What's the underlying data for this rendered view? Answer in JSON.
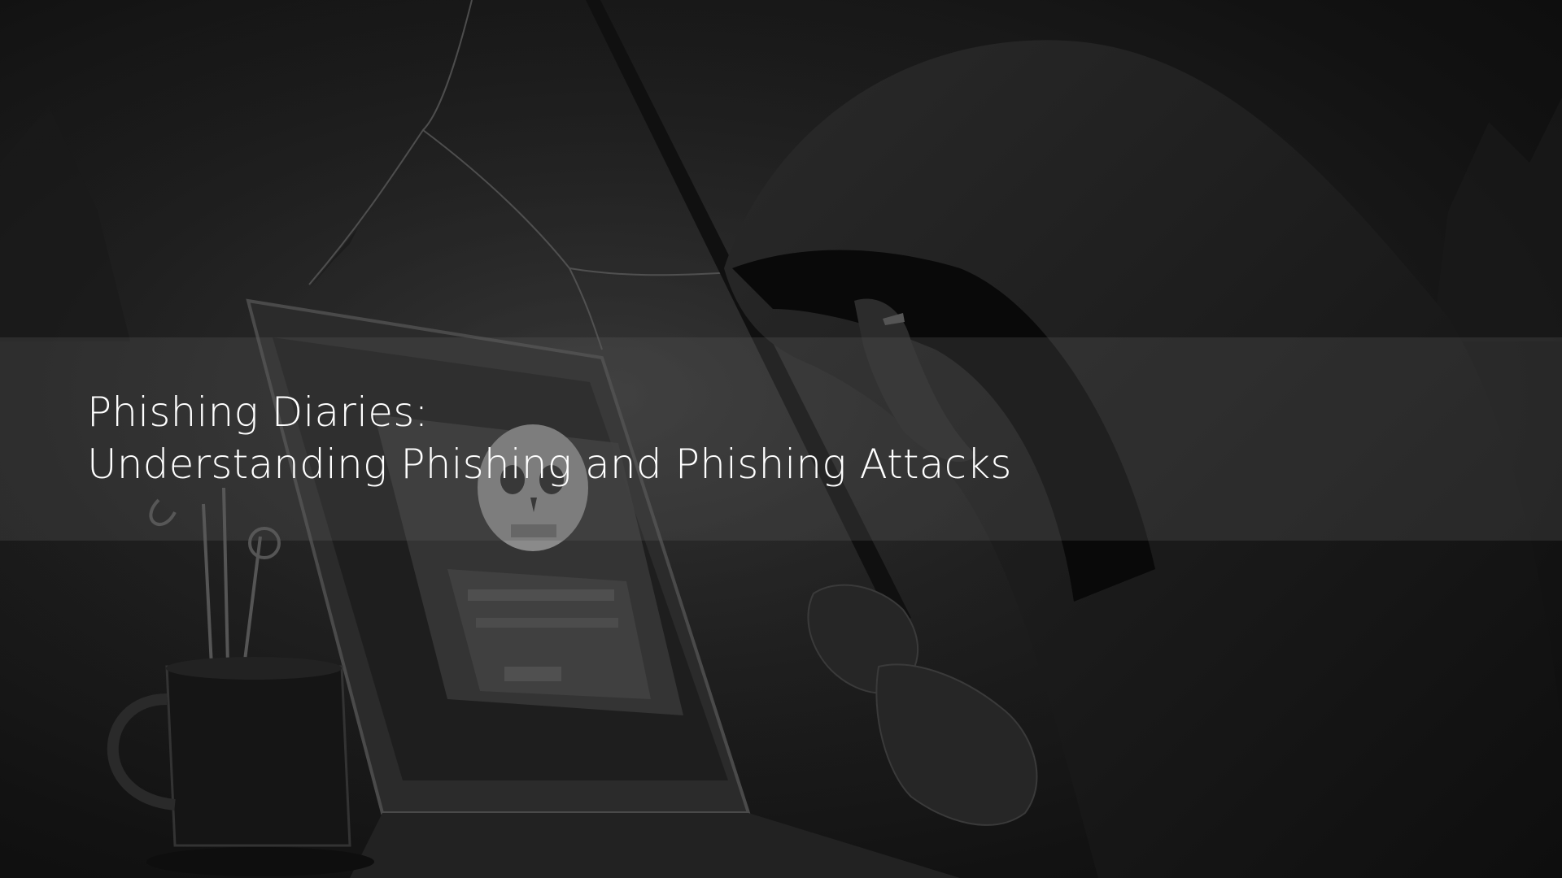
{
  "hero": {
    "title_line_1": "Phishing Diaries:",
    "title_line_2": "Understanding Phishing and Phishing Attacks"
  },
  "colors": {
    "background": "#141414",
    "title_text": "#ffffff",
    "band_overlay": "#5f5f5f"
  },
  "illustration": {
    "description_icon": "hooded-hacker-illustration"
  }
}
